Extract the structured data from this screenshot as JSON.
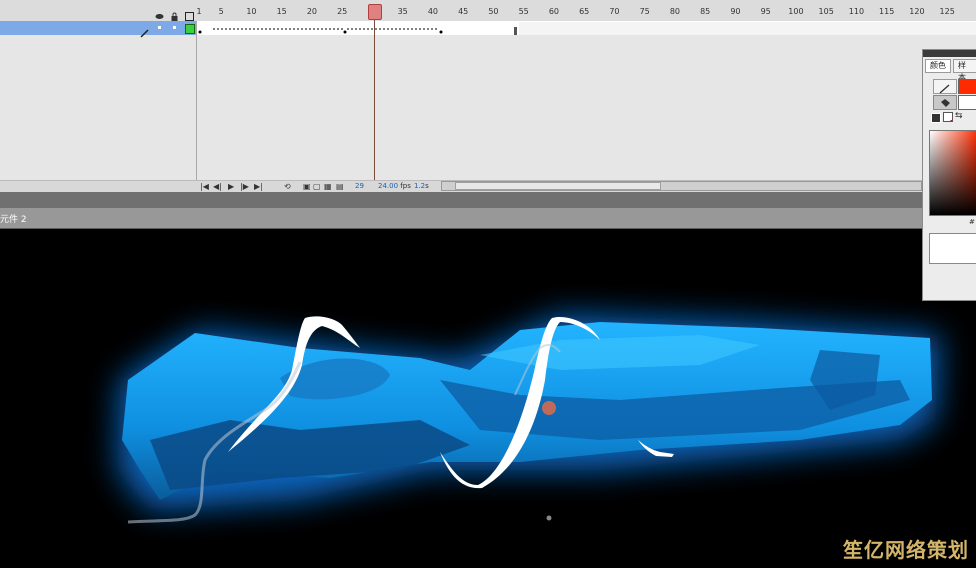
{
  "timeline": {
    "ruler_ticks": [
      "1",
      "5",
      "10",
      "15",
      "20",
      "25",
      "30",
      "35",
      "40",
      "45",
      "50",
      "55",
      "60",
      "65",
      "70",
      "75",
      "80",
      "85",
      "90",
      "95",
      "100",
      "105",
      "110",
      "115",
      "120",
      "125"
    ],
    "current_frame": "29",
    "fps": "24.00",
    "fps_unit": "fps",
    "elapsed_time": "1.2",
    "elapsed_unit": "s"
  },
  "scene": {
    "label": "元件 2"
  },
  "color_panel": {
    "tab_color": "颜色",
    "tab_swatches": "样本",
    "stroke_color": "#ff2a00",
    "fill_color": "#ffffff",
    "hex_prefix": "#"
  },
  "watermark": {
    "text": "笙亿网络策划"
  },
  "icons": [
    "eye-icon",
    "lock-icon",
    "outline-icon",
    "pencil-icon",
    "first-frame-icon",
    "prev-frame-icon",
    "play-icon",
    "next-frame-icon",
    "last-frame-icon",
    "loop-icon",
    "onion-skin-icon",
    "edit-multiple-frames-icon",
    "layer-color-icon"
  ],
  "colors": {
    "selected_layer": "#7da9e6",
    "stage_background": "#000000",
    "shape_blue": "#1aa7ff",
    "stroke_white": "#ffffff"
  }
}
